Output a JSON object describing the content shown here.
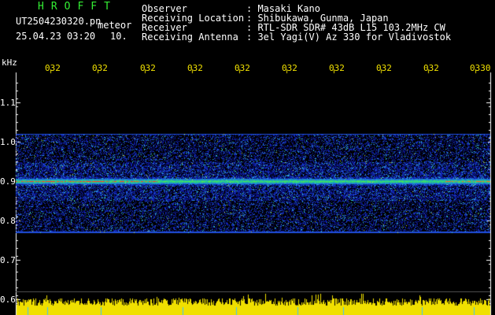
{
  "header": {
    "brand": "HROFFT",
    "filename": "UT2504230320.pn",
    "mode": "meteor",
    "datetime": "25.04.23 03:20",
    "count": "10."
  },
  "station": {
    "observer_label": "Observer",
    "observer_value": ": Masaki Kano",
    "location_label": "Receiving Location",
    "location_value": ": Shibukawa, Gunma, Japan",
    "receiver_label": "Receiver",
    "receiver_value": ": RTL-SDR SDR# 43dB L15 103.2MHz CW",
    "antenna_label": "Receiving Antenna",
    "antenna_value": ": 3el Yagi(V) Az 330 for Vladivostok"
  },
  "y_axis": {
    "unit": "kHz",
    "ticks": [
      "1.1",
      "1.0",
      "0.9",
      "0.8",
      "0.7",
      "0.6"
    ]
  },
  "x_axis": {
    "ticks": [
      "032",
      "032",
      "032",
      "032",
      "032",
      "032",
      "032",
      "032",
      "032",
      "0330"
    ]
  },
  "colors": {
    "background": "#000000",
    "band_base": "#0a1aa0",
    "signal_line": "#ff3030",
    "amplitude": "#f0e000",
    "grid": "#2a2a2a"
  }
}
